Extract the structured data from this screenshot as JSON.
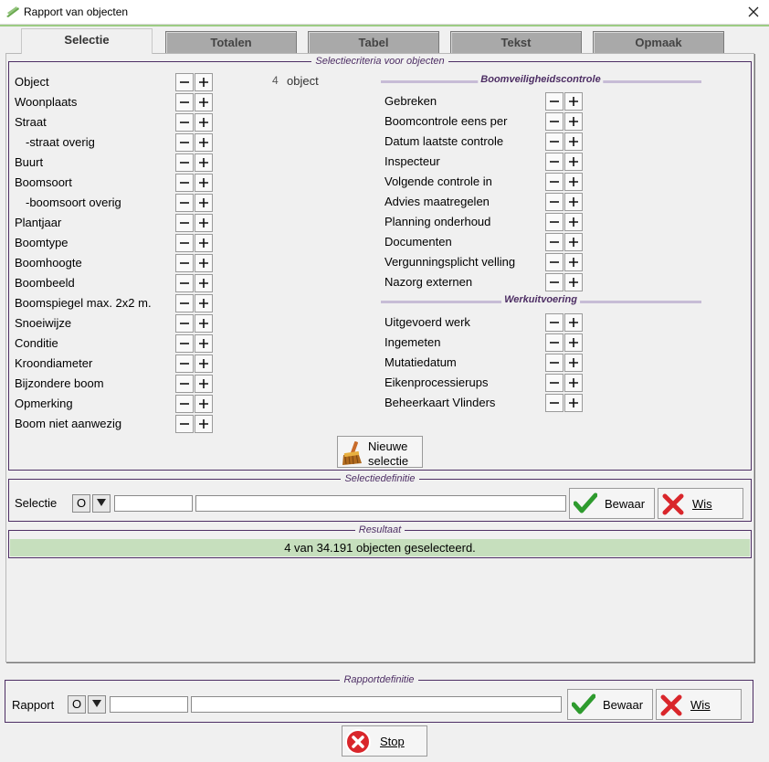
{
  "window": {
    "title": "Rapport van objecten"
  },
  "tabs": [
    {
      "label": "Selectie",
      "active": true
    },
    {
      "label": "Totalen",
      "active": false
    },
    {
      "label": "Tabel",
      "active": false
    },
    {
      "label": "Tekst",
      "active": false
    },
    {
      "label": "Opmaak",
      "active": false
    }
  ],
  "criteria": {
    "legend": "Selectiecriteria voor objecten",
    "object_count": "4",
    "object_unit": "object",
    "left_items": [
      "Object",
      "Woonplaats",
      "Straat",
      "-straat overig",
      "Buurt",
      "Boomsoort",
      "-boomsoort overig",
      "Plantjaar",
      "Boomtype",
      "Boomhoogte",
      "Boombeeld",
      "Boomspiegel max. 2x2 m.",
      "Snoeiwijze",
      "Conditie",
      "Kroondiameter",
      "Bijzondere boom",
      "Opmerking",
      "Boom niet aanwezig"
    ],
    "section1_title": "Boomveiligheidscontrole",
    "section1_items": [
      "Gebreken",
      "Boomcontrole eens per",
      "Datum laatste controle",
      "Inspecteur",
      "Volgende controle in",
      "Advies maatregelen",
      "Planning onderhoud",
      "Documenten",
      "Vergunningsplicht velling",
      "Nazorg externen"
    ],
    "section2_title": "Werkuitvoering",
    "section2_items": [
      "Uitgevoerd werk",
      "Ingemeten",
      "Mutatiedatum",
      "Eikenprocessierups",
      "Beheerkaart Vlinders"
    ],
    "new_selection_line1": "Nieuwe",
    "new_selection_line2": "selectie"
  },
  "selection_def": {
    "legend": "Selectiedefinitie",
    "label": "Selectie",
    "o_button": "O",
    "code_value": "",
    "name_value": "",
    "save_label": "Bewaar",
    "clear_label": "Wis"
  },
  "result": {
    "legend": "Resultaat",
    "text": "4 van 34.191 objecten geselecteerd."
  },
  "report_def": {
    "legend": "Rapportdefinitie",
    "label": "Rapport",
    "o_button": "O",
    "code_value": "",
    "name_value": "",
    "save_label": "Bewaar",
    "clear_label": "Wis"
  },
  "stop_label": "Stop",
  "colors": {
    "accent_purple": "#4d2e64",
    "result_green": "#c6dfbd",
    "check_green": "#2e9b2e",
    "cross_red": "#d9262b"
  },
  "icons": {
    "app": "app-icon",
    "close": "close-icon",
    "minus": "minus-icon",
    "plus": "plus-icon",
    "broom": "broom-icon",
    "check": "check-icon",
    "cross": "cross-icon",
    "stop": "stop-icon",
    "dropdown": "dropdown-arrow-icon"
  }
}
